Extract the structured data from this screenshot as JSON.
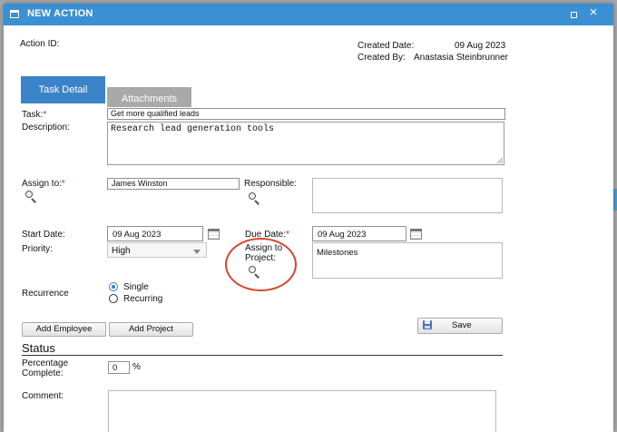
{
  "window": {
    "title": "NEW ACTION"
  },
  "header": {
    "action_id_label": "Action ID:",
    "created_date_label": "Created Date:",
    "created_date": "09 Aug 2023",
    "created_by_label": "Created By:",
    "created_by": "Anastasia Steinbrunner"
  },
  "tabs": [
    {
      "label": "Task Detail",
      "active": true
    },
    {
      "label": "Attachments",
      "active": false
    }
  ],
  "form": {
    "task_label": "Task:",
    "task_value": "Get more qualified leads",
    "description_label": "Description:",
    "description_value": "Research lead generation tools",
    "assign_to_label": "Assign to:",
    "assign_to_value": "James Winston",
    "responsible_label": "Responsible:",
    "responsible_value": "",
    "start_date_label": "Start Date:",
    "start_date_value": "09 Aug 2023",
    "due_date_label": "Due Date:",
    "due_date_value": "09 Aug 2023",
    "priority_label": "Priority:",
    "priority_value": "High",
    "assign_project_label_1": "Assign to",
    "assign_project_label_2": "Project:",
    "project_value": "Milestones",
    "recurrence_label": "Recurrence",
    "recurrence_options": [
      {
        "label": "Single",
        "selected": true
      },
      {
        "label": "Recurring",
        "selected": false
      }
    ],
    "required_marker": "*"
  },
  "buttons": {
    "add_employee": "Add Employee",
    "add_project": "Add Project",
    "save": "Save"
  },
  "status": {
    "title": "Status",
    "percentage_label_1": "Percentage",
    "percentage_label_2": "Complete:",
    "percentage_value": "0",
    "percent_sign": "%",
    "comment_label": "Comment:",
    "comment_value": ""
  },
  "colors": {
    "title_bar": "#3b8fd3",
    "active_tab": "#3b83c9",
    "inactive_tab": "#a9a9a9",
    "required": "#d21f1f",
    "highlight_circle": "#d9442b",
    "radio_selected": "#2f7fd0"
  }
}
